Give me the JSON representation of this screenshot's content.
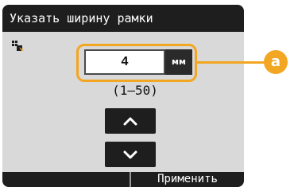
{
  "title": "Указать ширину рамки",
  "value_field": {
    "value": "4",
    "unit": "мм"
  },
  "range_text": "(1–50)",
  "callout_label": "a",
  "buttons": {
    "apply_label": "Применить"
  },
  "icons": {
    "copy": "copy-icon",
    "up": "chevron-up-icon",
    "down": "chevron-down-icon"
  },
  "colors": {
    "accent": "#f3a622",
    "dark": "#1e1e1e",
    "panel": "#d9d9d9"
  }
}
